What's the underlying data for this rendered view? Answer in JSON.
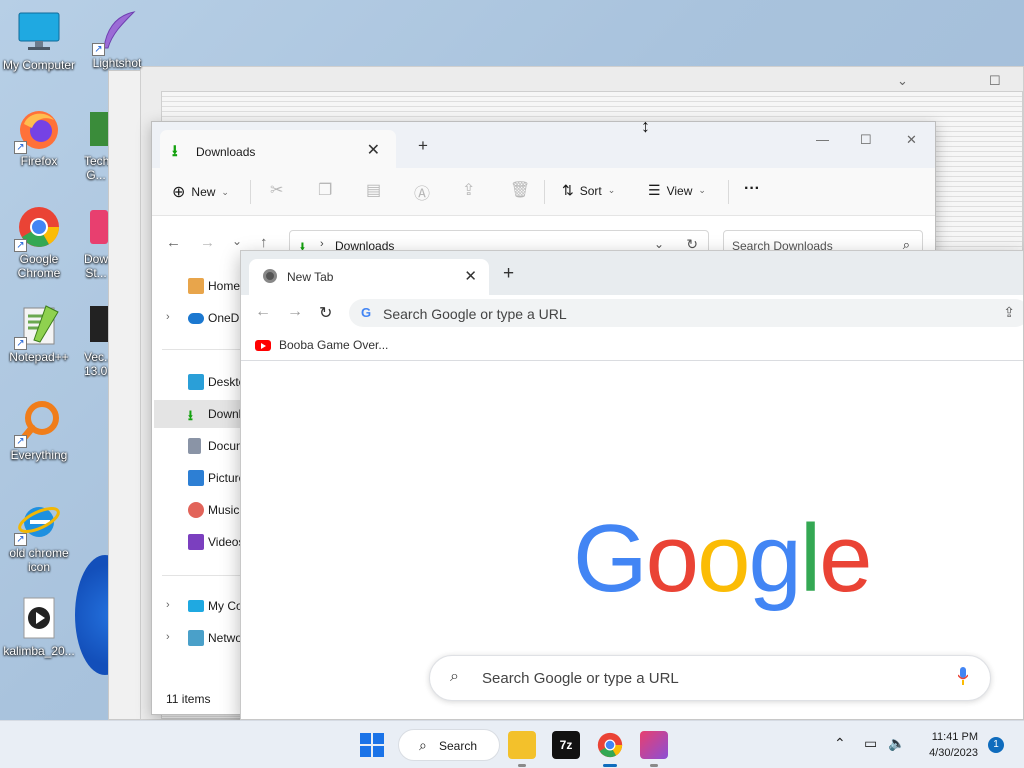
{
  "desktop": {
    "icons": [
      {
        "label": "My Computer"
      },
      {
        "label": "Lightshot"
      },
      {
        "label": "Firefox"
      },
      {
        "label": "TechPow... G..."
      },
      {
        "label": "Google Chrome"
      },
      {
        "label": "Dow... St..."
      },
      {
        "label": "Notepad++"
      },
      {
        "label": "Vec... 13.0..."
      },
      {
        "label": "Everything"
      },
      {
        "label": "old chrome icon"
      },
      {
        "label": "kalimba_20..."
      }
    ]
  },
  "explorer": {
    "tab_title": "Downloads",
    "toolbar": {
      "new_label": "New",
      "sort_label": "Sort",
      "view_label": "View",
      "more_label": "···"
    },
    "address": {
      "path": "Downloads",
      "search_placeholder": "Search Downloads"
    },
    "sidebar": [
      {
        "label": "Home"
      },
      {
        "label": "OneDrive"
      },
      {
        "label": "Desktop"
      },
      {
        "label": "Downloads"
      },
      {
        "label": "Documents"
      },
      {
        "label": "Pictures"
      },
      {
        "label": "Music"
      },
      {
        "label": "Videos"
      },
      {
        "label": "My Computer"
      },
      {
        "label": "Network"
      }
    ],
    "status": "11 items"
  },
  "chrome": {
    "tab_title": "New Tab",
    "omnibox_placeholder": "Search Google or type a URL",
    "bookmark": "Booba Game Over...",
    "logo_letters": [
      "G",
      "o",
      "o",
      "g",
      "l",
      "e"
    ],
    "search_placeholder": "Search Google or type a URL"
  },
  "taskbar": {
    "search_label": "Search",
    "time": "11:41 PM",
    "date": "4/30/2023",
    "notification_count": "1"
  },
  "colors": {
    "google_blue": "#4285f4",
    "google_red": "#ea4335",
    "google_yellow": "#fbbc05",
    "google_green": "#34a853",
    "downloads_green": "#13a10e",
    "accent": "#0f6cbd"
  }
}
